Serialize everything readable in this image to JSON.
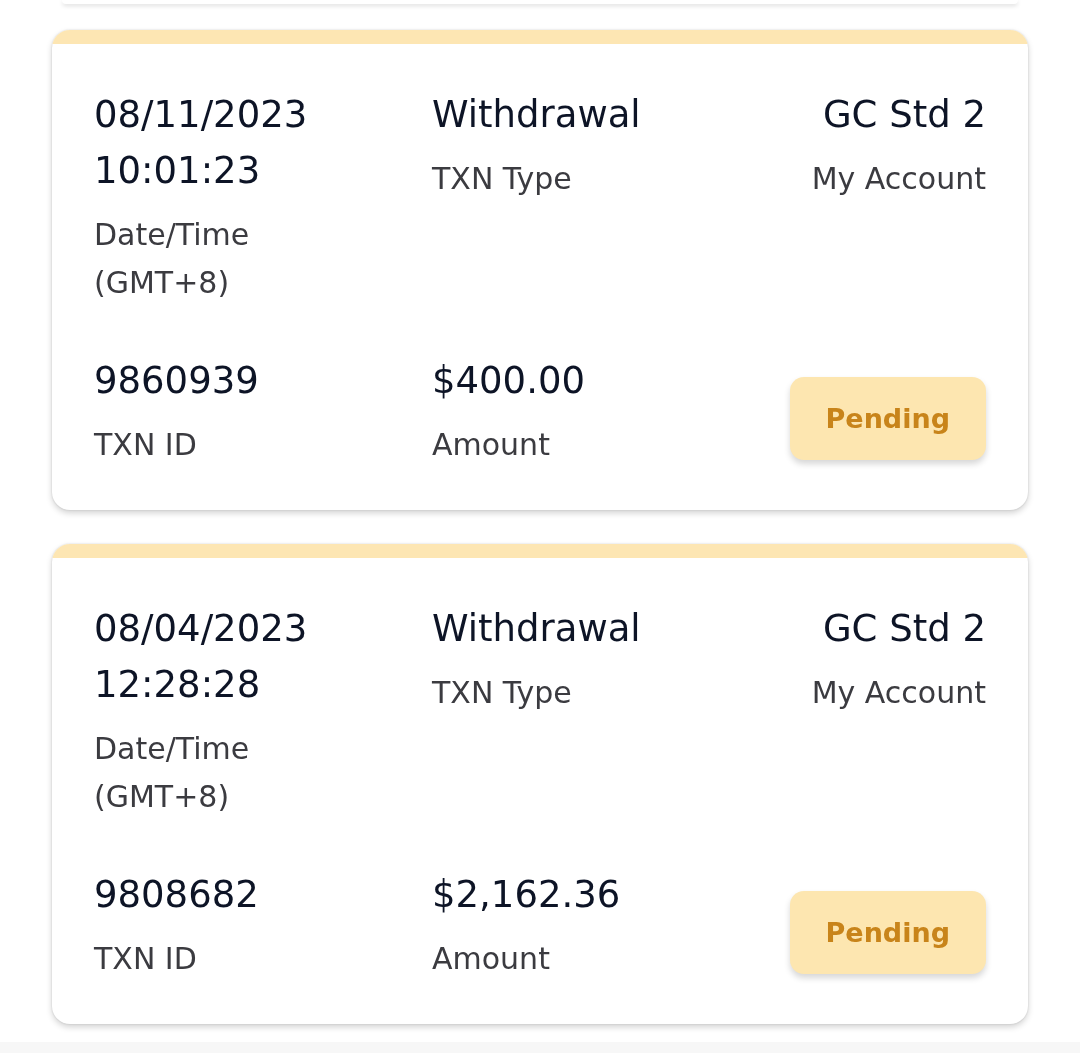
{
  "transactions": [
    {
      "date_time": "08/11/2023 10:01:23",
      "date_time_label": "Date/Time (GMT+8)",
      "txn_type": "Withdrawal",
      "txn_type_label": "TXN Type",
      "account": "GC Std 2",
      "account_label": "My Account",
      "txn_id": "9860939",
      "txn_id_label": "TXN ID",
      "amount": "$400.00",
      "amount_label": "Amount",
      "status": {
        "label": "Pending",
        "kind": "pending"
      }
    },
    {
      "date_time": "08/04/2023 12:28:28",
      "date_time_label": "Date/Time (GMT+8)",
      "txn_type": "Withdrawal",
      "txn_type_label": "TXN Type",
      "account": "GC Std 2",
      "account_label": "My Account",
      "txn_id": "9808682",
      "txn_id_label": "TXN ID",
      "amount": "$2,162.36",
      "amount_label": "Amount",
      "status": {
        "label": "Pending",
        "kind": "pending"
      }
    }
  ]
}
